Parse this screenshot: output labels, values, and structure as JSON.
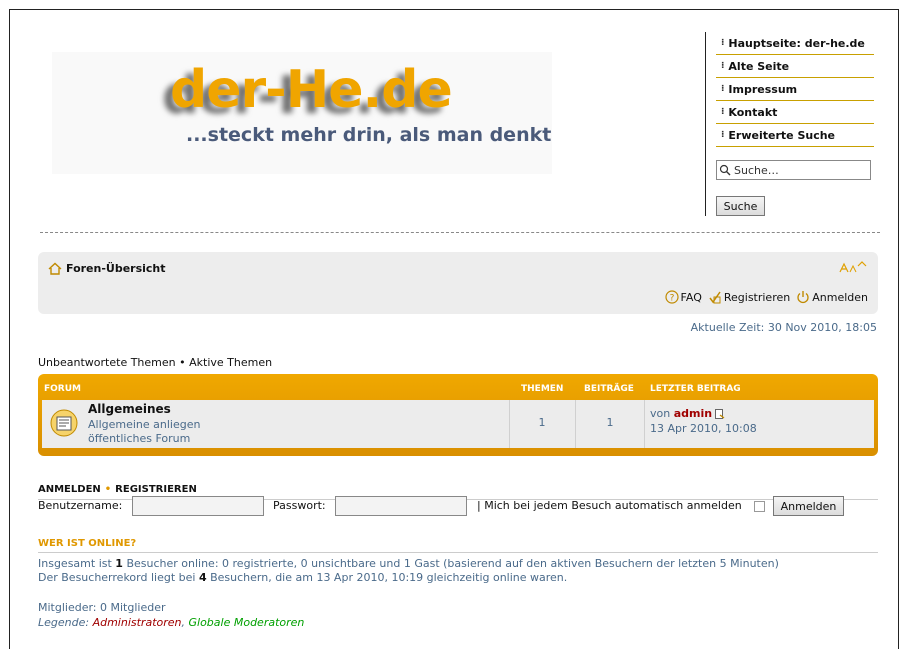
{
  "header": {
    "logo_title": "der-He.de",
    "logo_subtitle": "...steckt mehr drin, als man denkt"
  },
  "side_nav": [
    {
      "label": "Hauptseite: der-he.de"
    },
    {
      "label": "Alte Seite"
    },
    {
      "label": "Impressum"
    },
    {
      "label": "Kontakt"
    },
    {
      "label": "Erweiterte Suche"
    }
  ],
  "search": {
    "placeholder": "Suche…",
    "button": "Suche"
  },
  "navbar": {
    "breadcrumb": "Foren-Übersicht",
    "links": {
      "faq": "FAQ",
      "register": "Registrieren",
      "login": "Anmelden"
    }
  },
  "current_time": "Aktuelle Zeit: 30 Nov 2010, 18:05",
  "quicklinks": {
    "unanswered": "Unbeantwortete Themen",
    "sep": " • ",
    "active": "Aktive Themen"
  },
  "forum_table": {
    "headers": {
      "forum": "Forum",
      "topics": "Themen",
      "posts": "Beiträge",
      "last_post": "Letzter Beitrag"
    },
    "rows": [
      {
        "title": "Allgemeines",
        "desc_line1": "Allgemeine anliegen",
        "desc_line2": "öffentliches Forum",
        "topics": "1",
        "posts": "1",
        "last_by_prefix": "von ",
        "last_by": "admin",
        "last_date": "13 Apr 2010, 10:08"
      }
    ]
  },
  "login": {
    "head_login": "ANMELDEN",
    "head_dot": "•",
    "head_register": "REGISTRIEREN",
    "username_label": "Benutzername:",
    "password_label": "Passwort:",
    "auto_label": "| Mich bei jedem Besuch automatisch anmelden",
    "button": "Anmelden"
  },
  "online": {
    "head": "WER IST ONLINE?",
    "line1_a": "Insgesamt ist ",
    "line1_num": "1",
    "line1_b": " Besucher online: 0 registrierte, 0 unsichtbare und 1 Gast (basierend auf den aktiven Besuchern der letzten 5 Minuten)",
    "line2_a": "Der Besucherrekord liegt bei ",
    "line2_num": "4",
    "line2_b": " Besuchern, die am 13 Apr 2010, 10:19 gleichzeitig online waren.",
    "members": "Mitglieder: 0 Mitglieder",
    "legend_label": "Legende: ",
    "legend_admin": "Administratoren",
    "legend_sep": ", ",
    "legend_mod": "Globale Moderatoren"
  },
  "colors": {
    "accent": "#f0a500",
    "link": "#4a6a8a",
    "admin": "#a00000",
    "moderator": "#00a000"
  }
}
